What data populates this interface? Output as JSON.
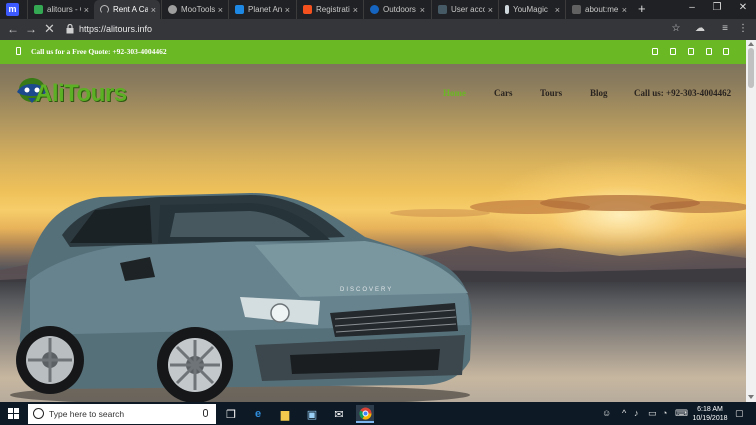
{
  "browser": {
    "tabs": [
      {
        "title": "alitours - G",
        "favicon_color": "#34a853",
        "active": false
      },
      {
        "title": "Rent A Car",
        "favicon_color": "#bdbdbd",
        "active": true
      },
      {
        "title": "MooTools",
        "favicon_color": "#9e9e9e",
        "active": false
      },
      {
        "title": "Planet Ana",
        "favicon_color": "#1e88e5",
        "active": false
      },
      {
        "title": "Registratio",
        "favicon_color": "#f4511e",
        "active": false
      },
      {
        "title": "Outdoors",
        "favicon_color": "#1565c0",
        "active": false
      },
      {
        "title": "User accou",
        "favicon_color": "#455a64",
        "active": false
      },
      {
        "title": "YouMagic",
        "favicon_color": "#cfd8dc",
        "active": false
      },
      {
        "title": "about:me",
        "favicon_color": "#616161",
        "active": false
      }
    ],
    "close_glyph": "×",
    "new_tab_glyph": "+",
    "window_controls": {
      "minimize": "–",
      "maximize": "❐",
      "close": "✕"
    },
    "url": "https://alitours.info"
  },
  "site": {
    "quote_text": "Call us for a Free Quote: +92-303-4004462",
    "logo_text": "AliTours",
    "nav": {
      "home": "Home",
      "cars": "Cars",
      "tours": "Tours",
      "blog": "Blog",
      "call": "Call us: +92-303-4004462"
    },
    "accent_color": "#6ab823"
  },
  "taskbar": {
    "search_placeholder": "Type here to search",
    "time": "6:18 AM",
    "date": "10/19/2018"
  }
}
